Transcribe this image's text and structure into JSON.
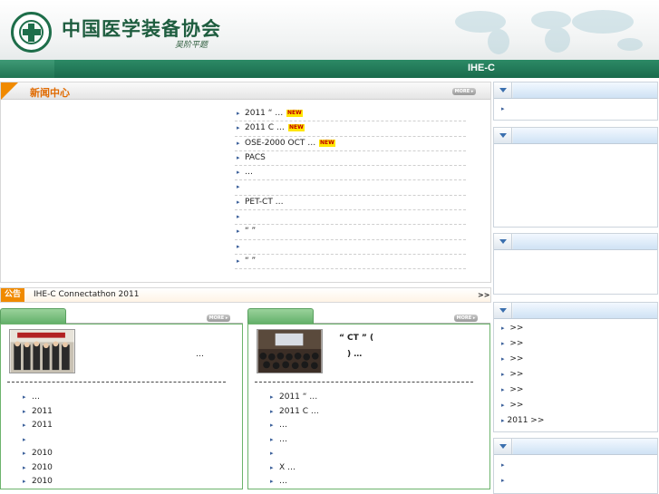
{
  "header": {
    "org_name": "中国医学装备协会",
    "signature": "吴阶平题"
  },
  "nav": {
    "ihe_label": "IHE-C"
  },
  "news": {
    "title": "新闻中心",
    "more_label": "MORE ▸",
    "new_badge": "NEW",
    "items": [
      {
        "text": "2011 “         …",
        "new": true
      },
      {
        "text": "2011            C …",
        "new": true
      },
      {
        "text": "         OSE-2000 OCT …",
        "new": true
      },
      {
        "text": "    PACS",
        "new": false
      },
      {
        "text": "                     …",
        "new": false
      },
      {
        "text": "",
        "new": false
      },
      {
        "text": "      PET-CT         …",
        "new": false
      },
      {
        "text": "",
        "new": false
      },
      {
        "text": "        “   ”",
        "new": false
      },
      {
        "text": "",
        "new": false
      },
      {
        "text": "          “ ”",
        "new": false
      }
    ]
  },
  "notice": {
    "label": "公告",
    "text": "IHE-C Connectathon 2011",
    "more": ">>"
  },
  "panel_a": {
    "more_label": "MORE ▸",
    "feature_dots": "…",
    "items": [
      "              …",
      "2011",
      "2011",
      "",
      "2010",
      "   2010",
      "2010"
    ]
  },
  "panel_b": {
    "more_label": "MORE ▸",
    "feature_title": "“         CT                        ”          (",
    "feature_sub": ")         …",
    "items": [
      "2011 “           …",
      "2011            C …",
      "                  …",
      "                  …",
      "",
      "           X         …",
      "                  …"
    ]
  },
  "right": {
    "box1_items": [
      ""
    ],
    "box4_items": [
      "      >>",
      "        >>",
      "          >>",
      "              >>",
      "             >>",
      "      >>",
      "2011          >>"
    ],
    "box5_items": [
      "",
      ""
    ]
  }
}
